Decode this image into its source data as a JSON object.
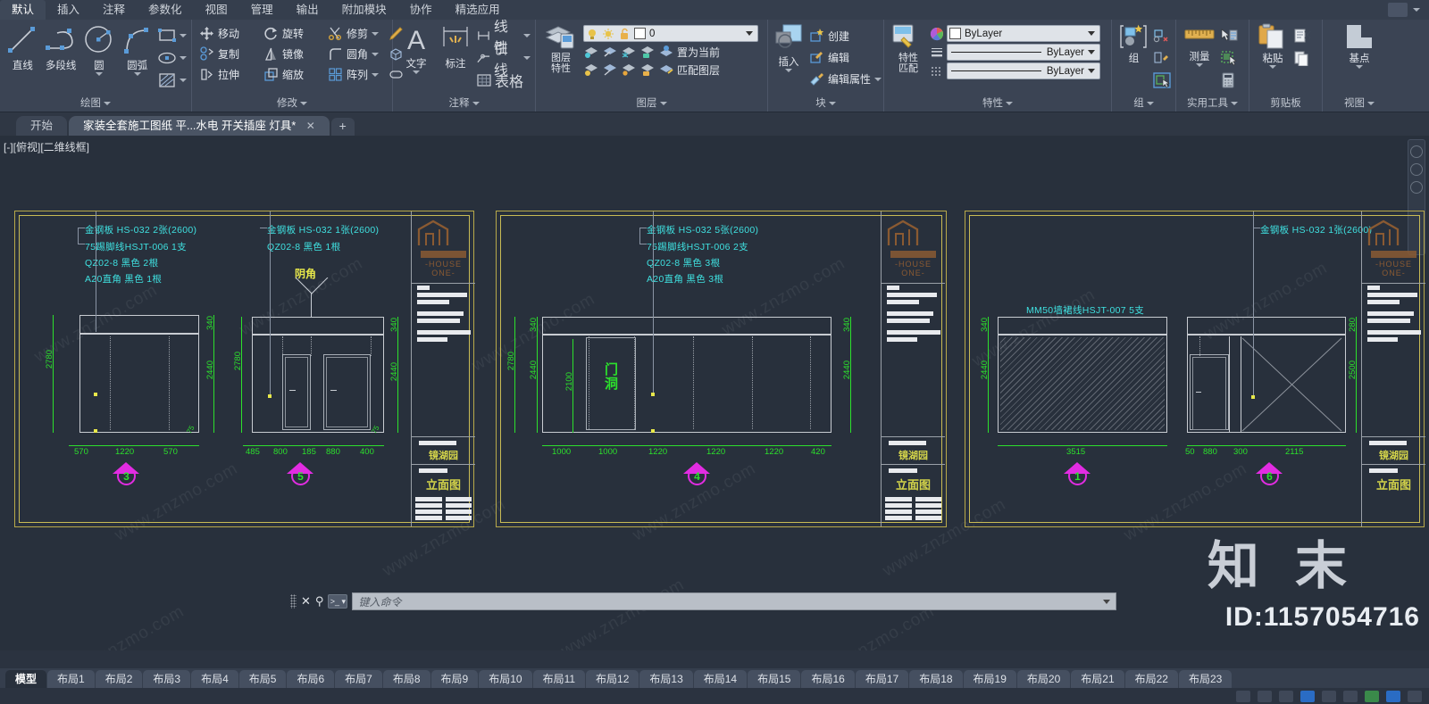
{
  "ribbon": {
    "tabs": [
      {
        "label": "默认",
        "active": true
      },
      {
        "label": "插入",
        "active": false
      },
      {
        "label": "注释",
        "active": false
      },
      {
        "label": "参数化",
        "active": false
      },
      {
        "label": "视图",
        "active": false
      },
      {
        "label": "管理",
        "active": false
      },
      {
        "label": "输出",
        "active": false
      },
      {
        "label": "附加模块",
        "active": false
      },
      {
        "label": "协作",
        "active": false
      },
      {
        "label": "精选应用",
        "active": false
      }
    ],
    "panels": {
      "draw": {
        "title": "绘图",
        "big": [
          {
            "label": "直线",
            "icon": "line-icon"
          },
          {
            "label": "多段线",
            "icon": "polyline-icon"
          },
          {
            "label": "圆",
            "icon": "circle-icon"
          },
          {
            "label": "圆弧",
            "icon": "arc-icon"
          }
        ],
        "small": [
          "rectangle-icon",
          "ellipse-icon",
          "hatch-icon"
        ]
      },
      "modify": {
        "title": "修改",
        "items": [
          {
            "label": "移动",
            "icon": "move-icon"
          },
          {
            "label": "旋转",
            "icon": "rotate-icon"
          },
          {
            "label": "修剪",
            "icon": "trim-icon"
          },
          {
            "label": "复制",
            "icon": "copy-icon"
          },
          {
            "label": "镜像",
            "icon": "mirror-icon"
          },
          {
            "label": "圆角",
            "icon": "fillet-icon"
          },
          {
            "label": "拉伸",
            "icon": "stretch-icon"
          },
          {
            "label": "缩放",
            "icon": "scale-icon"
          },
          {
            "label": "阵列",
            "icon": "array-icon"
          }
        ],
        "extras": [
          "erase-pencil-icon",
          "explode-box-icon",
          "offset-icon"
        ]
      },
      "annotation": {
        "title": "注释",
        "text_label": "文字",
        "dim_label": "标注",
        "items": [
          {
            "label": "线性",
            "icon": "linear-dim-icon"
          },
          {
            "label": "引线",
            "icon": "leader-icon"
          },
          {
            "label": "表格",
            "icon": "table-icon"
          }
        ]
      },
      "layer": {
        "title": "图层",
        "props_label": "图层特性",
        "current_layer": "0",
        "items": [
          {
            "label": "置为当前",
            "icon": "set-current-layer-icon"
          },
          {
            "label": "匹配图层",
            "icon": "match-layer-icon"
          }
        ]
      },
      "block": {
        "title": "块",
        "insert_label": "插入",
        "items": [
          {
            "label": "创建",
            "icon": "create-block-icon"
          },
          {
            "label": "编辑",
            "icon": "edit-block-icon"
          },
          {
            "label": "编辑属性",
            "icon": "edit-attribute-icon"
          }
        ]
      },
      "properties": {
        "title": "特性",
        "match_label": "特性匹配",
        "color_value": "ByLayer",
        "linewidth_value": "ByLayer",
        "linetype_value": "ByLayer"
      },
      "groups": {
        "title": "组",
        "label": "组"
      },
      "utilities": {
        "title": "实用工具",
        "label": "测量"
      },
      "clipboard": {
        "title": "剪贴板",
        "label": "粘贴"
      },
      "view": {
        "title": "视图",
        "label": "基点"
      }
    }
  },
  "doctabs": {
    "items": [
      {
        "label": "开始",
        "active": false,
        "closable": false
      },
      {
        "label": "家装全套施工图纸 平...水电 开关插座 灯具*",
        "active": true,
        "closable": true
      }
    ],
    "close_glyph": "✕",
    "add_glyph": "+"
  },
  "viewport": {
    "label": "[-][俯视][二维线框]"
  },
  "drawings": [
    {
      "id": "elev-3",
      "marker": "3",
      "notes": [
        "金钢板  HS-032  2张(2600)",
        "75踢脚线HSJT-006  1支",
        "QZ02-8  黑色  2根",
        "A20直角  黑色  1根"
      ],
      "dims_bottom": [
        "570",
        "1220",
        "570"
      ],
      "dims_left": [
        "2780"
      ],
      "dims_right": [
        "340",
        "2440"
      ],
      "small_dim": "75"
    },
    {
      "id": "elev-5",
      "marker": "5",
      "notes": [
        "金钢板  HS-032  1张(2600)",
        "QZ02-8  黑色  1根"
      ],
      "callout": "阴角",
      "dims_bottom": [
        "485",
        "800",
        "185",
        "880",
        "400"
      ],
      "dims_left": [
        "2780"
      ],
      "dims_right": [
        "340",
        "2440"
      ],
      "small_dim": "75"
    },
    {
      "id": "elev-4",
      "marker": "4",
      "notes": [
        "金钢板  HS-032  5张(2600)",
        "75踢脚线HSJT-006  2支",
        "QZ02-8  黑色  3根",
        "A20直角  黑色  3根"
      ],
      "opening_label": "门\n洞",
      "opening_height": "2100",
      "dims_bottom": [
        "1000",
        "1000",
        "1220",
        "1220",
        "1220",
        "420"
      ],
      "dims_left": [
        "2780"
      ],
      "dims_right": [
        "340",
        "2440"
      ],
      "dims_left_inner": [
        "340",
        "2440"
      ]
    },
    {
      "id": "elev-1",
      "marker": "1",
      "notes": [
        "MM50墙裙线HSJT-007 5支"
      ],
      "dims_bottom": [
        "3515"
      ],
      "dims_left": [
        "340",
        "2440"
      ]
    },
    {
      "id": "elev-6",
      "marker": "6",
      "notes": [
        "金钢板  HS-032  1张(2600)"
      ],
      "dims_bottom": [
        "50",
        "880",
        "300",
        "2115"
      ],
      "dims_right": [
        "280",
        "2500"
      ]
    }
  ],
  "titleblock": {
    "logo_text": "-HOUSE ONE-",
    "project": "镜湖园",
    "sheet_type": "立面图"
  },
  "command": {
    "placeholder": "键入命令",
    "close_glyph": "✕",
    "wrench_glyph": "⚲",
    "prompt_glyph": "▭"
  },
  "layouts": {
    "items": [
      "模型",
      "布局1",
      "布局2",
      "布局3",
      "布局4",
      "布局5",
      "布局6",
      "布局7",
      "布局8",
      "布局9",
      "布局10",
      "布局11",
      "布局12",
      "布局13",
      "布局14",
      "布局15",
      "布局16",
      "布局17",
      "布局18",
      "布局19",
      "布局20",
      "布局21",
      "布局22",
      "布局23"
    ],
    "active": "模型"
  },
  "watermarks": {
    "site_text": "www.znzmo.com",
    "brand": "知 末",
    "id_text": "ID:1157054716"
  },
  "colors": {
    "ribbon_bg": "#3b4454",
    "canvas_bg": "#28303c",
    "cyan_text": "#3fe0e0",
    "green_dim": "#2ce02c",
    "yellow_text": "#e8e84a",
    "magenta_marker": "#e22ce2",
    "sheet_border": "#c9bb55"
  }
}
